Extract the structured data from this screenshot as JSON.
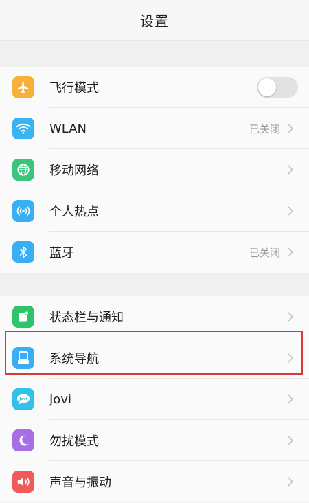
{
  "header": {
    "title": "设置"
  },
  "colors": {
    "airplane": "#f7b13a",
    "wlan": "#3ab3f2",
    "mobile": "#3cc47c",
    "hotspot": "#3aaef2",
    "bluetooth": "#3aaef2",
    "statusbar": "#2fc36a",
    "navigation": "#3aaef2",
    "jovi": "#32c1e8",
    "dnd": "#a86ee8",
    "sound": "#f15a5a",
    "highlight": "#d9383a"
  },
  "group1": [
    {
      "label": "飞行模式",
      "icon": "airplane-icon",
      "control": "toggle",
      "on": false
    },
    {
      "label": "WLAN",
      "icon": "wifi-icon",
      "status": "已关闭"
    },
    {
      "label": "移动网络",
      "icon": "globe-icon"
    },
    {
      "label": "个人热点",
      "icon": "hotspot-icon"
    },
    {
      "label": "蓝牙",
      "icon": "bluetooth-icon",
      "status": "已关闭"
    }
  ],
  "group2": [
    {
      "label": "状态栏与通知",
      "icon": "statusbar-icon"
    },
    {
      "label": "系统导航",
      "icon": "navigation-icon",
      "highlighted": true
    },
    {
      "label": "Jovi",
      "icon": "jovi-icon"
    },
    {
      "label": "勿扰模式",
      "icon": "moon-icon"
    },
    {
      "label": "声音与振动",
      "icon": "sound-icon"
    }
  ]
}
